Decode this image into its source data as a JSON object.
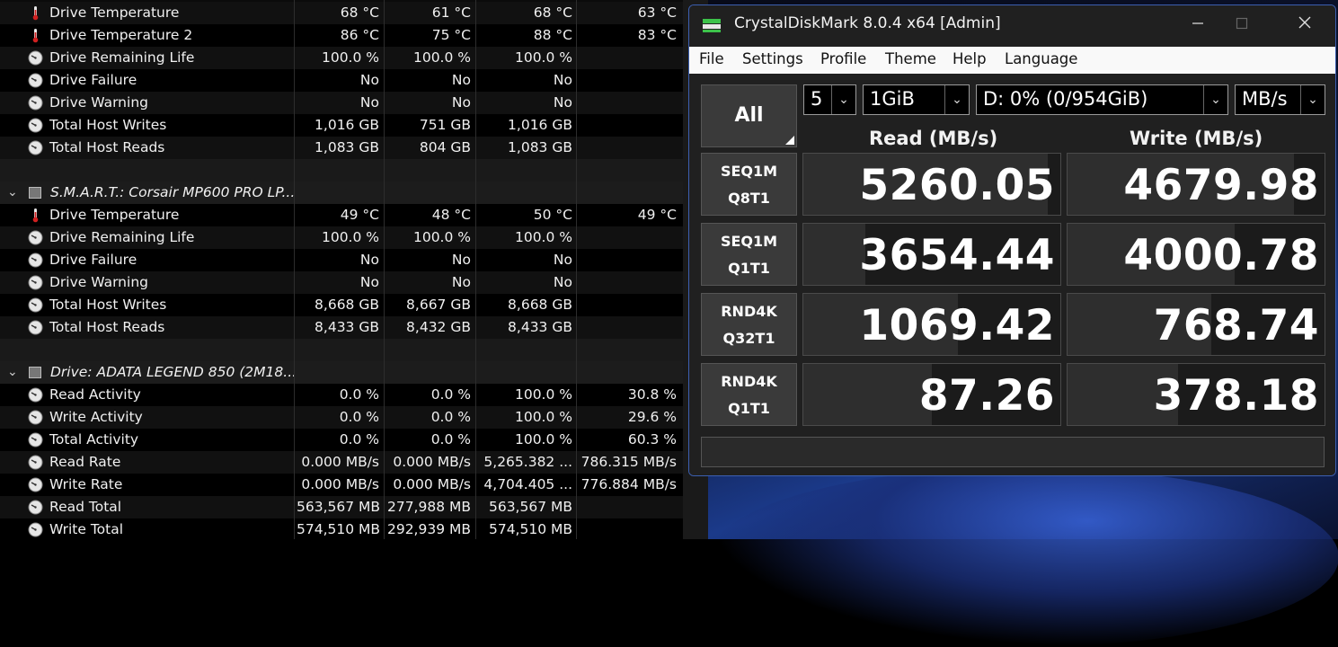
{
  "hwinfo": {
    "rows": [
      {
        "kind": "temp",
        "label": "Drive Temperature",
        "v": [
          "68 °C",
          "61 °C",
          "68 °C",
          "63 °C"
        ]
      },
      {
        "kind": "temp",
        "label": "Drive Temperature 2",
        "v": [
          "86 °C",
          "75 °C",
          "88 °C",
          "83 °C"
        ]
      },
      {
        "kind": "clock",
        "label": "Drive Remaining Life",
        "v": [
          "100.0 %",
          "100.0 %",
          "100.0 %",
          ""
        ]
      },
      {
        "kind": "clock",
        "label": "Drive Failure",
        "v": [
          "No",
          "No",
          "No",
          ""
        ]
      },
      {
        "kind": "clock",
        "label": "Drive Warning",
        "v": [
          "No",
          "No",
          "No",
          ""
        ]
      },
      {
        "kind": "clock",
        "label": "Total Host Writes",
        "v": [
          "1,016 GB",
          "751 GB",
          "1,016 GB",
          ""
        ]
      },
      {
        "kind": "clock",
        "label": "Total Host Reads",
        "v": [
          "1,083 GB",
          "804 GB",
          "1,083 GB",
          ""
        ]
      },
      {
        "kind": "blank",
        "label": "",
        "v": [
          "",
          "",
          "",
          ""
        ]
      },
      {
        "kind": "section",
        "label": "S.M.A.R.T.: Corsair MP600 PRO LP...",
        "v": [
          "",
          "",
          "",
          ""
        ]
      },
      {
        "kind": "temp",
        "label": "Drive Temperature",
        "v": [
          "49 °C",
          "48 °C",
          "50 °C",
          "49 °C"
        ]
      },
      {
        "kind": "clock",
        "label": "Drive Remaining Life",
        "v": [
          "100.0 %",
          "100.0 %",
          "100.0 %",
          ""
        ]
      },
      {
        "kind": "clock",
        "label": "Drive Failure",
        "v": [
          "No",
          "No",
          "No",
          ""
        ]
      },
      {
        "kind": "clock",
        "label": "Drive Warning",
        "v": [
          "No",
          "No",
          "No",
          ""
        ]
      },
      {
        "kind": "clock",
        "label": "Total Host Writes",
        "v": [
          "8,668 GB",
          "8,667 GB",
          "8,668 GB",
          ""
        ]
      },
      {
        "kind": "clock",
        "label": "Total Host Reads",
        "v": [
          "8,433 GB",
          "8,432 GB",
          "8,433 GB",
          ""
        ]
      },
      {
        "kind": "blank",
        "label": "",
        "v": [
          "",
          "",
          "",
          ""
        ]
      },
      {
        "kind": "section",
        "label": "Drive: ADATA LEGEND 850 (2M18...",
        "v": [
          "",
          "",
          "",
          ""
        ]
      },
      {
        "kind": "clock",
        "label": "Read Activity",
        "v": [
          "0.0 %",
          "0.0 %",
          "100.0 %",
          "30.8 %"
        ]
      },
      {
        "kind": "clock",
        "label": "Write Activity",
        "v": [
          "0.0 %",
          "0.0 %",
          "100.0 %",
          "29.6 %"
        ]
      },
      {
        "kind": "clock",
        "label": "Total Activity",
        "v": [
          "0.0 %",
          "0.0 %",
          "100.0 %",
          "60.3 %"
        ]
      },
      {
        "kind": "clock",
        "label": "Read Rate",
        "v": [
          "0.000 MB/s",
          "0.000 MB/s",
          "5,265.382 ...",
          "786.315 MB/s"
        ]
      },
      {
        "kind": "clock",
        "label": "Write Rate",
        "v": [
          "0.000 MB/s",
          "0.000 MB/s",
          "4,704.405 ...",
          "776.884 MB/s"
        ]
      },
      {
        "kind": "clock",
        "label": "Read Total",
        "v": [
          "563,567 MB",
          "277,988 MB",
          "563,567 MB",
          ""
        ]
      },
      {
        "kind": "clock",
        "label": "Write Total",
        "v": [
          "574,510 MB",
          "292,939 MB",
          "574,510 MB",
          ""
        ]
      }
    ]
  },
  "cdm": {
    "title": "CrystalDiskMark 8.0.4 x64 [Admin]",
    "menu": [
      "File",
      "Settings",
      "Profile",
      "Theme",
      "Help",
      "Language"
    ],
    "all_label": "All",
    "count": "5",
    "size": "1GiB",
    "drive": "D: 0% (0/954GiB)",
    "unit": "MB/s",
    "read_header": "Read (MB/s)",
    "write_header": "Write (MB/s)",
    "tests": [
      {
        "l1": "SEQ1M",
        "l2": "Q8T1",
        "read": "5260.05",
        "write": "4679.98",
        "read_frac": 0.95,
        "write_frac": 0.88
      },
      {
        "l1": "SEQ1M",
        "l2": "Q1T1",
        "read": "3654.44",
        "write": "4000.78",
        "read_frac": 0.24,
        "write_frac": 0.65
      },
      {
        "l1": "RND4K",
        "l2": "Q32T1",
        "read": "1069.42",
        "write": "768.74",
        "read_frac": 0.6,
        "write_frac": 0.56
      },
      {
        "l1": "RND4K",
        "l2": "Q1T1",
        "read": "87.26",
        "write": "378.18",
        "read_frac": 0.5,
        "write_frac": 0.43
      }
    ],
    "status": ""
  }
}
